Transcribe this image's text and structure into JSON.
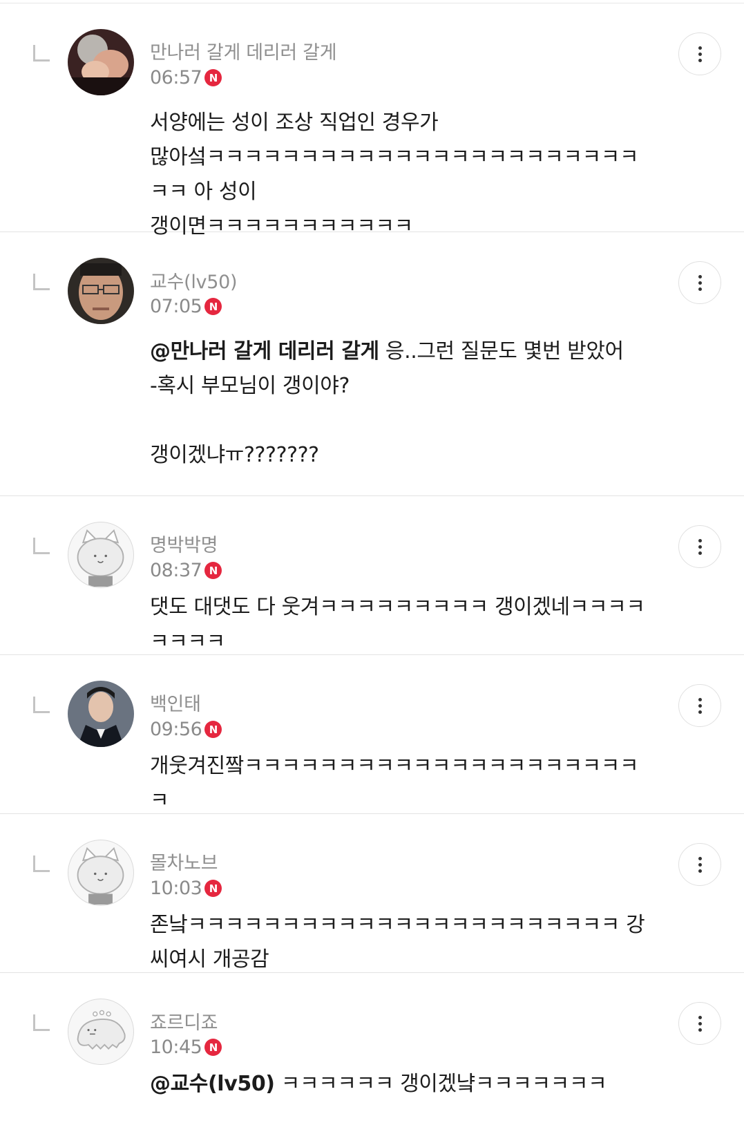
{
  "comments": [
    {
      "nickname": "만나러 갈게 데리러 갈게",
      "time": "06:57",
      "badge": "N",
      "mention": "",
      "text": "서양에는 성이 조상 직업인 경우가\n많아섴ㅋㅋㅋㅋㅋㅋㅋㅋㅋㅋㅋㅋㅋㅋㅋㅋㅋㅋㅋㅋㅋㅋㅋㅋㅋ 아 성이\n갱이면ㅋㅋㅋㅋㅋㅋㅋㅋㅋㅋㅋ",
      "avatar_icon": "photo-avatar-icon"
    },
    {
      "nickname": "교수(lv50)",
      "time": "07:05",
      "badge": "N",
      "mention": "@만나러 갈게 데리러 갈게",
      "text": " 응..그런 질문도 몇번 받았어\n-혹시 부모님이 갱이야?\n\n갱이겠냐ㅠ???????",
      "avatar_icon": "photo-avatar-icon"
    },
    {
      "nickname": "명박박명",
      "time": "08:37",
      "badge": "N",
      "mention": "",
      "text": "댓도 대댓도 다 웃겨ㅋㅋㅋㅋㅋㅋㅋㅋㅋ 갱이겠네ㅋㅋㅋㅋㅋㅋㅋㅋ",
      "avatar_icon": "default-cat-avatar-icon"
    },
    {
      "nickname": "백인태",
      "time": "09:56",
      "badge": "N",
      "mention": "",
      "text": "개웃겨진짴ㅋㅋㅋㅋㅋㅋㅋㅋㅋㅋㅋㅋㅋㅋㅋㅋㅋㅋㅋㅋㅋㅋ",
      "avatar_icon": "photo-avatar-icon"
    },
    {
      "nickname": "몰차노브",
      "time": "10:03",
      "badge": "N",
      "mention": "",
      "text": "존낰ㅋㅋㅋㅋㅋㅋㅋㅋㅋㅋㅋㅋㅋㅋㅋㅋㅋㅋㅋㅋㅋㅋㅋ 강씨여시 개공감",
      "avatar_icon": "default-cat-avatar-icon"
    },
    {
      "nickname": "죠르디죠",
      "time": "10:45",
      "badge": "N",
      "mention": "@교수(lv50)",
      "text": " ㅋㅋㅋㅋㅋㅋ 갱이겠냨ㅋㅋㅋㅋㅋㅋㅋ",
      "avatar_icon": "default-dino-avatar-icon"
    }
  ],
  "colors": {
    "nickname": "#8f8f8f",
    "time": "#8a8a8a",
    "body_text": "#1c1c1c",
    "new_badge": "#e5273f",
    "divider": "#e3e3e3",
    "reply_mark": "#c4c4c4"
  },
  "icons": {
    "reply": "reply-arrow-icon",
    "more": "more-vertical-icon",
    "new": "new-badge-icon"
  }
}
